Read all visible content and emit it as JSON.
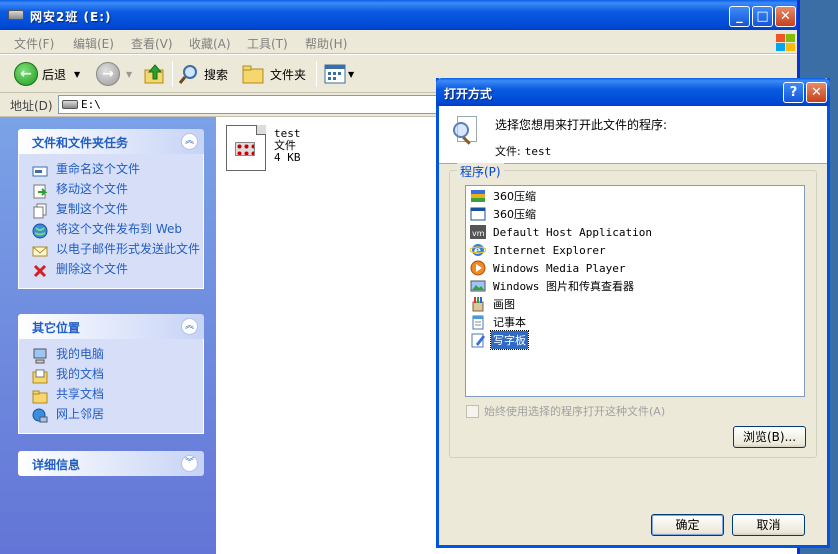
{
  "explorer": {
    "title": "网安2班 (E:)",
    "menu": [
      "文件(F)",
      "编辑(E)",
      "查看(V)",
      "收藏(A)",
      "工具(T)",
      "帮助(H)"
    ],
    "toolbar": {
      "back_label": "后退",
      "search_label": "搜索",
      "folders_label": "文件夹"
    },
    "address": {
      "label": "地址(D)",
      "value": "E:\\"
    },
    "file_tasks": {
      "header": "文件和文件夹任务",
      "items": [
        "重命名这个文件",
        "移动这个文件",
        "复制这个文件",
        "将这个文件发布到 Web",
        "以电子邮件形式发送此文件",
        "删除这个文件"
      ]
    },
    "other_places": {
      "header": "其它位置",
      "items": [
        "我的电脑",
        "我的文档",
        "共享文档",
        "网上邻居"
      ]
    },
    "details": {
      "header": "详细信息"
    },
    "file": {
      "name": "test",
      "type": "文件",
      "size": "4 KB"
    }
  },
  "dialog": {
    "title": "打开方式",
    "prompt": "选择您想用来打开此文件的程序:",
    "file_label": "文件:",
    "file_name": "test",
    "programs_label": "程序(P)",
    "programs": [
      {
        "label": "360压缩",
        "icon": "archive-stack-icon"
      },
      {
        "label": "360压缩",
        "icon": "window-icon"
      },
      {
        "label": "Default Host Application",
        "icon": "vm-icon"
      },
      {
        "label": "Internet Explorer",
        "icon": "internet-explorer-icon"
      },
      {
        "label": "Windows Media Player",
        "icon": "media-player-icon"
      },
      {
        "label": "Windows 图片和传真查看器",
        "icon": "picture-viewer-icon"
      },
      {
        "label": "画图",
        "icon": "paint-icon"
      },
      {
        "label": "记事本",
        "icon": "notepad-icon"
      },
      {
        "label": "写字板",
        "icon": "wordpad-icon"
      }
    ],
    "selected_program": "写字板",
    "always_use_label": "始终使用选择的程序打开这种文件(A)",
    "browse_label": "浏览(B)...",
    "ok_label": "确定",
    "cancel_label": "取消"
  }
}
